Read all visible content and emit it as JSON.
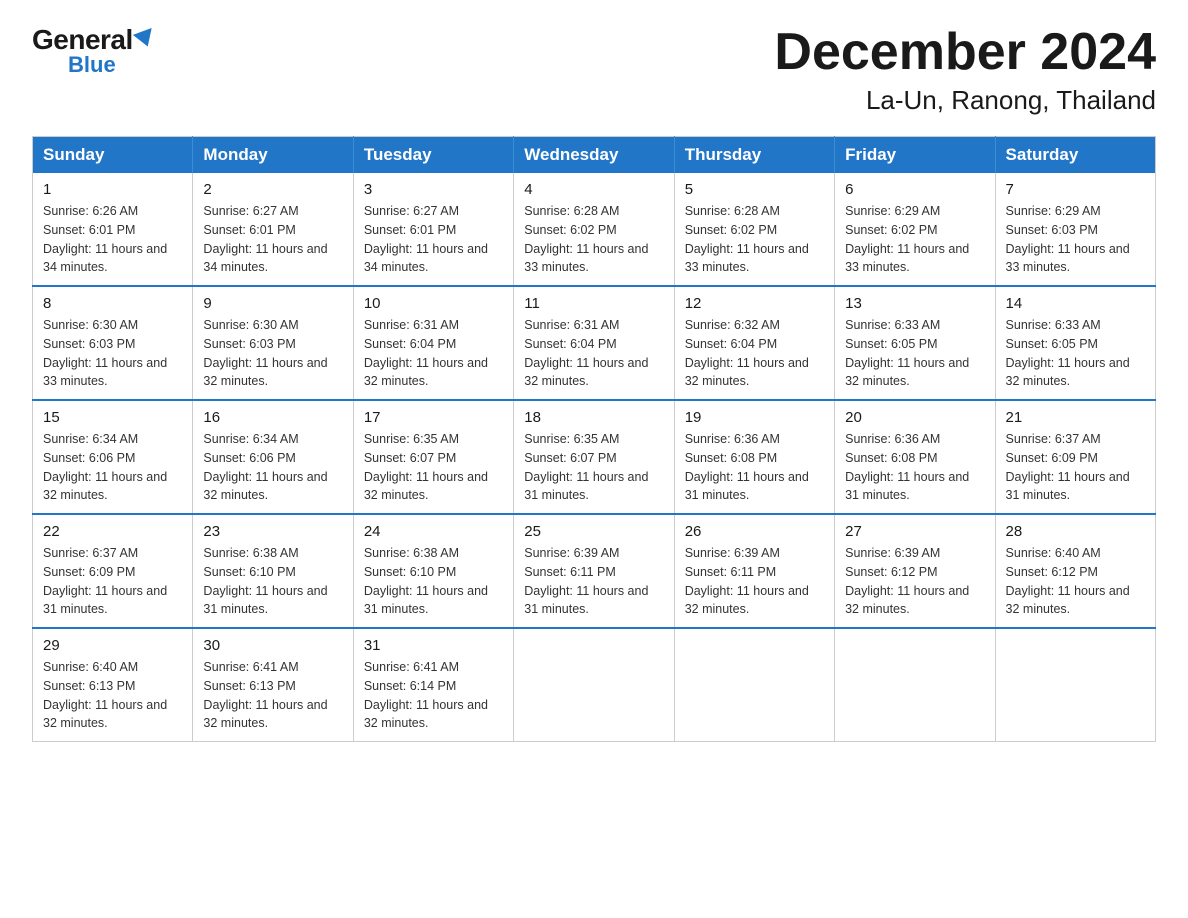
{
  "logo": {
    "general": "General",
    "blue": "Blue",
    "triangle": "▲"
  },
  "title": "December 2024",
  "subtitle": "La-Un, Ranong, Thailand",
  "days_of_week": [
    "Sunday",
    "Monday",
    "Tuesday",
    "Wednesday",
    "Thursday",
    "Friday",
    "Saturday"
  ],
  "weeks": [
    [
      {
        "day": "1",
        "sunrise": "6:26 AM",
        "sunset": "6:01 PM",
        "daylight": "11 hours and 34 minutes."
      },
      {
        "day": "2",
        "sunrise": "6:27 AM",
        "sunset": "6:01 PM",
        "daylight": "11 hours and 34 minutes."
      },
      {
        "day": "3",
        "sunrise": "6:27 AM",
        "sunset": "6:01 PM",
        "daylight": "11 hours and 34 minutes."
      },
      {
        "day": "4",
        "sunrise": "6:28 AM",
        "sunset": "6:02 PM",
        "daylight": "11 hours and 33 minutes."
      },
      {
        "day": "5",
        "sunrise": "6:28 AM",
        "sunset": "6:02 PM",
        "daylight": "11 hours and 33 minutes."
      },
      {
        "day": "6",
        "sunrise": "6:29 AM",
        "sunset": "6:02 PM",
        "daylight": "11 hours and 33 minutes."
      },
      {
        "day": "7",
        "sunrise": "6:29 AM",
        "sunset": "6:03 PM",
        "daylight": "11 hours and 33 minutes."
      }
    ],
    [
      {
        "day": "8",
        "sunrise": "6:30 AM",
        "sunset": "6:03 PM",
        "daylight": "11 hours and 33 minutes."
      },
      {
        "day": "9",
        "sunrise": "6:30 AM",
        "sunset": "6:03 PM",
        "daylight": "11 hours and 32 minutes."
      },
      {
        "day": "10",
        "sunrise": "6:31 AM",
        "sunset": "6:04 PM",
        "daylight": "11 hours and 32 minutes."
      },
      {
        "day": "11",
        "sunrise": "6:31 AM",
        "sunset": "6:04 PM",
        "daylight": "11 hours and 32 minutes."
      },
      {
        "day": "12",
        "sunrise": "6:32 AM",
        "sunset": "6:04 PM",
        "daylight": "11 hours and 32 minutes."
      },
      {
        "day": "13",
        "sunrise": "6:33 AM",
        "sunset": "6:05 PM",
        "daylight": "11 hours and 32 minutes."
      },
      {
        "day": "14",
        "sunrise": "6:33 AM",
        "sunset": "6:05 PM",
        "daylight": "11 hours and 32 minutes."
      }
    ],
    [
      {
        "day": "15",
        "sunrise": "6:34 AM",
        "sunset": "6:06 PM",
        "daylight": "11 hours and 32 minutes."
      },
      {
        "day": "16",
        "sunrise": "6:34 AM",
        "sunset": "6:06 PM",
        "daylight": "11 hours and 32 minutes."
      },
      {
        "day": "17",
        "sunrise": "6:35 AM",
        "sunset": "6:07 PM",
        "daylight": "11 hours and 32 minutes."
      },
      {
        "day": "18",
        "sunrise": "6:35 AM",
        "sunset": "6:07 PM",
        "daylight": "11 hours and 31 minutes."
      },
      {
        "day": "19",
        "sunrise": "6:36 AM",
        "sunset": "6:08 PM",
        "daylight": "11 hours and 31 minutes."
      },
      {
        "day": "20",
        "sunrise": "6:36 AM",
        "sunset": "6:08 PM",
        "daylight": "11 hours and 31 minutes."
      },
      {
        "day": "21",
        "sunrise": "6:37 AM",
        "sunset": "6:09 PM",
        "daylight": "11 hours and 31 minutes."
      }
    ],
    [
      {
        "day": "22",
        "sunrise": "6:37 AM",
        "sunset": "6:09 PM",
        "daylight": "11 hours and 31 minutes."
      },
      {
        "day": "23",
        "sunrise": "6:38 AM",
        "sunset": "6:10 PM",
        "daylight": "11 hours and 31 minutes."
      },
      {
        "day": "24",
        "sunrise": "6:38 AM",
        "sunset": "6:10 PM",
        "daylight": "11 hours and 31 minutes."
      },
      {
        "day": "25",
        "sunrise": "6:39 AM",
        "sunset": "6:11 PM",
        "daylight": "11 hours and 31 minutes."
      },
      {
        "day": "26",
        "sunrise": "6:39 AM",
        "sunset": "6:11 PM",
        "daylight": "11 hours and 32 minutes."
      },
      {
        "day": "27",
        "sunrise": "6:39 AM",
        "sunset": "6:12 PM",
        "daylight": "11 hours and 32 minutes."
      },
      {
        "day": "28",
        "sunrise": "6:40 AM",
        "sunset": "6:12 PM",
        "daylight": "11 hours and 32 minutes."
      }
    ],
    [
      {
        "day": "29",
        "sunrise": "6:40 AM",
        "sunset": "6:13 PM",
        "daylight": "11 hours and 32 minutes."
      },
      {
        "day": "30",
        "sunrise": "6:41 AM",
        "sunset": "6:13 PM",
        "daylight": "11 hours and 32 minutes."
      },
      {
        "day": "31",
        "sunrise": "6:41 AM",
        "sunset": "6:14 PM",
        "daylight": "11 hours and 32 minutes."
      },
      null,
      null,
      null,
      null
    ]
  ]
}
